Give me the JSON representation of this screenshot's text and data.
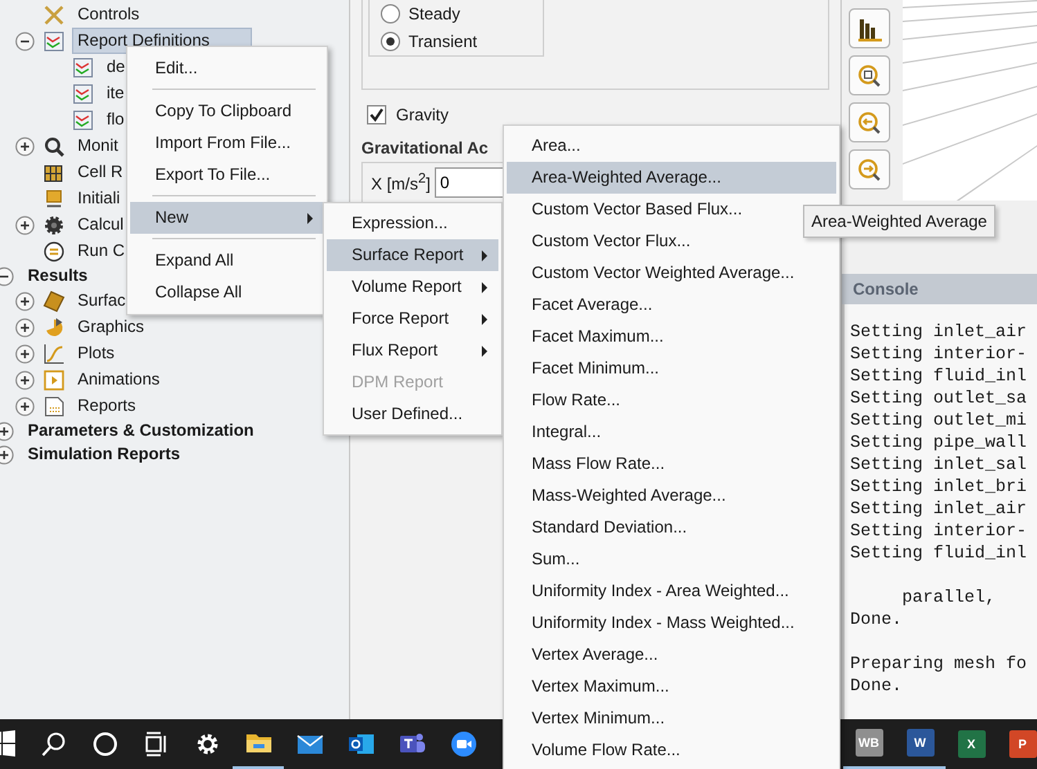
{
  "tree": {
    "continued": [
      {
        "kind": "tools",
        "label": "Controls",
        "selected": false
      },
      {
        "kind": "report",
        "label": "Report Definitions",
        "expanded": true,
        "selected": true,
        "children": [
          {
            "kind": "report",
            "label": "de",
            "selected": false
          },
          {
            "kind": "report",
            "label": "ite",
            "selected": false
          },
          {
            "kind": "report",
            "label": "flo",
            "selected": false
          }
        ]
      },
      {
        "kind": "monitor",
        "label": "Monit",
        "expanded": false,
        "selected": false
      },
      {
        "kind": "cells",
        "label": "Cell R",
        "selected": false
      },
      {
        "kind": "init",
        "label": "Initiali",
        "selected": false
      },
      {
        "kind": "gear",
        "label": "Calcul",
        "expanded": false,
        "selected": false
      },
      {
        "kind": "equals",
        "label": "Run C",
        "selected": false
      }
    ],
    "sections": [
      {
        "kind": "section",
        "label": "Results",
        "expanded": true,
        "selected": false,
        "children": [
          {
            "kind": "surface",
            "label": "Surfac",
            "expanded": false,
            "selected": false
          },
          {
            "kind": "graphics",
            "label": "Graphics",
            "expanded": false,
            "selected": false
          },
          {
            "kind": "plots",
            "label": "Plots",
            "expanded": false,
            "selected": false
          },
          {
            "kind": "animations",
            "label": "Animations",
            "expanded": false,
            "selected": false
          },
          {
            "kind": "reports",
            "label": "Reports",
            "expanded": false,
            "selected": false
          }
        ]
      },
      {
        "kind": "section",
        "label": "Parameters & Customization",
        "expanded": false,
        "selected": false
      },
      {
        "kind": "section",
        "label": "Simulation Reports",
        "expanded": false,
        "selected": false
      }
    ]
  },
  "settings": {
    "time": [
      {
        "label": "Steady",
        "selected": false
      },
      {
        "label": "Transient",
        "selected": true
      }
    ],
    "gravity": {
      "label": "Gravity",
      "checked": true
    },
    "gravity_heading": "Gravitational Ac",
    "field": {
      "label": "X [m/s$^{2}$]",
      "value": "0"
    }
  },
  "tooltip": "Area-Weighted Average",
  "console": {
    "title": "Console",
    "blocks": [
      [
        "Setting inlet_air",
        "Setting interior-",
        "Setting fluid_inl",
        "Setting outlet_sa",
        "Setting outlet_mi",
        "Setting pipe_wall",
        "Setting inlet_sal",
        "Setting inlet_bri",
        "Setting inlet_air",
        "Setting interior-",
        "Setting fluid_inl"
      ],
      [
        "     parallel,",
        "Done."
      ],
      [
        "Preparing mesh fo",
        "Done."
      ]
    ]
  },
  "context_menu": [
    {
      "kind": "item",
      "label": "Edit...",
      "selected": false,
      "disabled": false
    },
    {
      "kind": "separator"
    },
    {
      "kind": "item",
      "label": "Copy To Clipboard",
      "selected": false,
      "disabled": false
    },
    {
      "kind": "item",
      "label": "Import From File...",
      "selected": false,
      "disabled": false
    },
    {
      "kind": "item",
      "label": "Export To File...",
      "selected": false,
      "disabled": false
    },
    {
      "kind": "separator"
    },
    {
      "kind": "submenu",
      "label": "New",
      "selected": true,
      "disabled": false
    },
    {
      "kind": "separator"
    },
    {
      "kind": "item",
      "label": "Expand All",
      "selected": false,
      "disabled": false
    },
    {
      "kind": "item",
      "label": "Collapse All",
      "selected": false,
      "disabled": false
    }
  ],
  "new_menu": [
    {
      "kind": "item",
      "label": "Expression...",
      "selected": false,
      "disabled": false
    },
    {
      "kind": "submenu",
      "label": "Surface Report",
      "selected": true,
      "disabled": false
    },
    {
      "kind": "submenu",
      "label": "Volume Report",
      "selected": false,
      "disabled": false
    },
    {
      "kind": "submenu",
      "label": "Force Report",
      "selected": false,
      "disabled": false
    },
    {
      "kind": "submenu",
      "label": "Flux Report",
      "selected": false,
      "disabled": false
    },
    {
      "kind": "item",
      "label": "DPM Report",
      "selected": false,
      "disabled": true
    },
    {
      "kind": "item",
      "label": "User Defined...",
      "selected": false,
      "disabled": false
    }
  ],
  "surface_report_menu": [
    {
      "kind": "item",
      "label": "Area...",
      "selected": false,
      "disabled": false
    },
    {
      "kind": "item",
      "label": "Area-Weighted Average...",
      "selected": true,
      "disabled": false
    },
    {
      "kind": "item",
      "label": "Custom Vector Based Flux...",
      "selected": false,
      "disabled": false
    },
    {
      "kind": "item",
      "label": "Custom Vector Flux...",
      "selected": false,
      "disabled": false
    },
    {
      "kind": "item",
      "label": "Custom Vector Weighted Average...",
      "selected": false,
      "disabled": false
    },
    {
      "kind": "item",
      "label": "Facet Average...",
      "selected": false,
      "disabled": false
    },
    {
      "kind": "item",
      "label": "Facet Maximum...",
      "selected": false,
      "disabled": false
    },
    {
      "kind": "item",
      "label": "Facet Minimum...",
      "selected": false,
      "disabled": false
    },
    {
      "kind": "item",
      "label": "Flow Rate...",
      "selected": false,
      "disabled": false
    },
    {
      "kind": "item",
      "label": "Integral...",
      "selected": false,
      "disabled": false
    },
    {
      "kind": "item",
      "label": "Mass Flow Rate...",
      "selected": false,
      "disabled": false
    },
    {
      "kind": "item",
      "label": "Mass-Weighted Average...",
      "selected": false,
      "disabled": false
    },
    {
      "kind": "item",
      "label": "Standard Deviation...",
      "selected": false,
      "disabled": false
    },
    {
      "kind": "item",
      "label": "Sum...",
      "selected": false,
      "disabled": false
    },
    {
      "kind": "item",
      "label": "Uniformity Index - Area Weighted...",
      "selected": false,
      "disabled": false
    },
    {
      "kind": "item",
      "label": "Uniformity Index - Mass Weighted...",
      "selected": false,
      "disabled": false
    },
    {
      "kind": "item",
      "label": "Vertex Average...",
      "selected": false,
      "disabled": false
    },
    {
      "kind": "item",
      "label": "Vertex Maximum...",
      "selected": false,
      "disabled": false
    },
    {
      "kind": "item",
      "label": "Vertex Minimum...",
      "selected": false,
      "disabled": false
    },
    {
      "kind": "item",
      "label": "Volume Flow Rate...",
      "selected": false,
      "disabled": false
    }
  ],
  "taskbar": {
    "pinned": [
      {
        "kind": "start",
        "running": false
      },
      {
        "kind": "search",
        "running": false
      },
      {
        "kind": "cortana",
        "running": false
      },
      {
        "kind": "taskview",
        "running": false
      },
      {
        "kind": "settings",
        "running": false
      },
      {
        "kind": "folder",
        "running": true
      },
      {
        "kind": "mail",
        "running": false
      },
      {
        "kind": "outlook",
        "running": false
      },
      {
        "kind": "teams",
        "running": false
      },
      {
        "kind": "video",
        "running": false
      }
    ],
    "apps": [
      {
        "label": "WB",
        "color": "#8f8f8f",
        "running": true
      },
      {
        "label": "W",
        "color": "#2b579a",
        "running": true
      },
      {
        "label": "X",
        "color": "#217346",
        "running": false
      },
      {
        "label": "P",
        "color": "#d24726",
        "running": false
      }
    ]
  }
}
